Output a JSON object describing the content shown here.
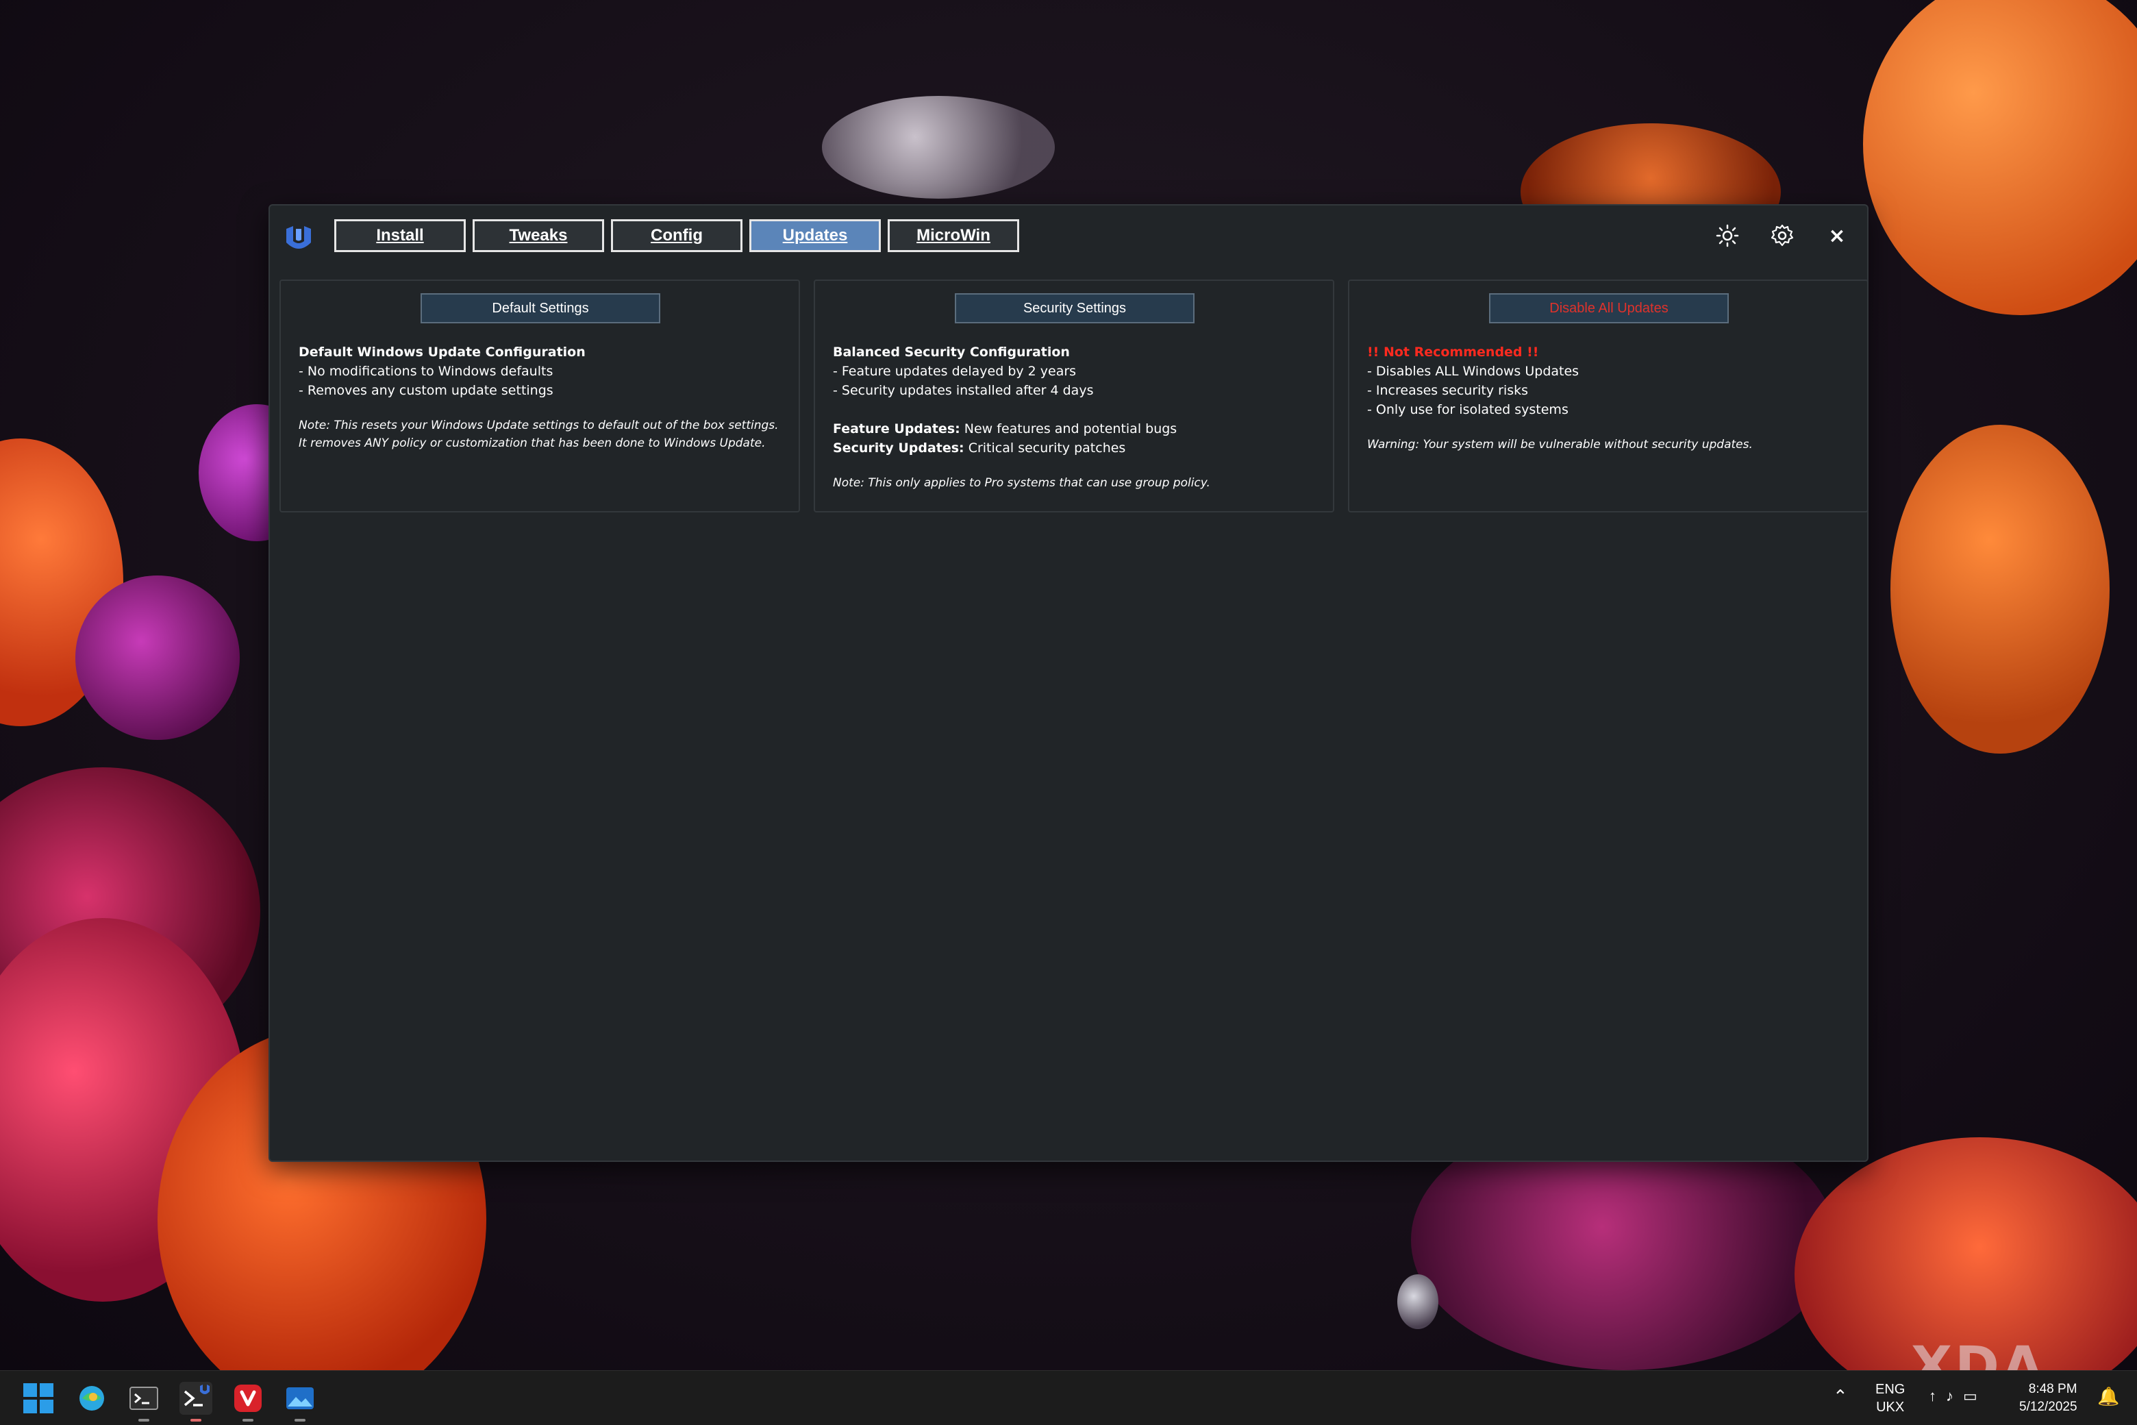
{
  "tabs": [
    {
      "label": "Install",
      "active": false
    },
    {
      "label": "Tweaks",
      "active": false
    },
    {
      "label": "Config",
      "active": false
    },
    {
      "label": "Updates",
      "active": true
    },
    {
      "label": "MicroWin",
      "active": false
    }
  ],
  "window_controls": {
    "theme_icon": "sun-icon",
    "settings_icon": "gear-icon",
    "close_label": "×"
  },
  "panels": [
    {
      "button": "Default Settings",
      "title": "Default Windows Update Configuration",
      "bullets": [
        "- No modifications to Windows defaults",
        "- Removes any custom update settings"
      ],
      "note": "Note: This resets your Windows Update settings to default out of the box settings. It removes ANY policy or customization that has been done to Windows Update."
    },
    {
      "button": "Security Settings",
      "title": "Balanced Security Configuration",
      "bullets": [
        "- Feature updates delayed by 2 years",
        "- Security updates installed after 4 days"
      ],
      "kv": [
        {
          "key": "Feature Updates:",
          "value": " New features and potential bugs"
        },
        {
          "key": "Security Updates:",
          "value": " Critical security patches"
        }
      ],
      "note": "Note: This only applies to Pro systems that can use group policy."
    },
    {
      "button": "Disable All Updates",
      "title": "!! Not Recommended !!",
      "bullets": [
        "- Disables ALL Windows Updates",
        "- Increases security risks",
        "- Only use for isolated systems"
      ],
      "note": "Warning: Your system will be vulnerable without security updates."
    }
  ],
  "taskbar": {
    "apps": [
      "start-icon",
      "browser-icon",
      "terminal-icon",
      "powershell-winutil-icon",
      "vivaldi-icon",
      "photos-icon"
    ],
    "lang_top": "ENG",
    "lang_bottom": "UKX",
    "time": "8:48 PM",
    "date": "5/12/2025"
  },
  "watermark": "XDA",
  "colors": {
    "accent_tab": "#5b85b9",
    "danger": "#ff2a1f",
    "window_bg": "#212528",
    "button_bg": "#273b4d"
  }
}
